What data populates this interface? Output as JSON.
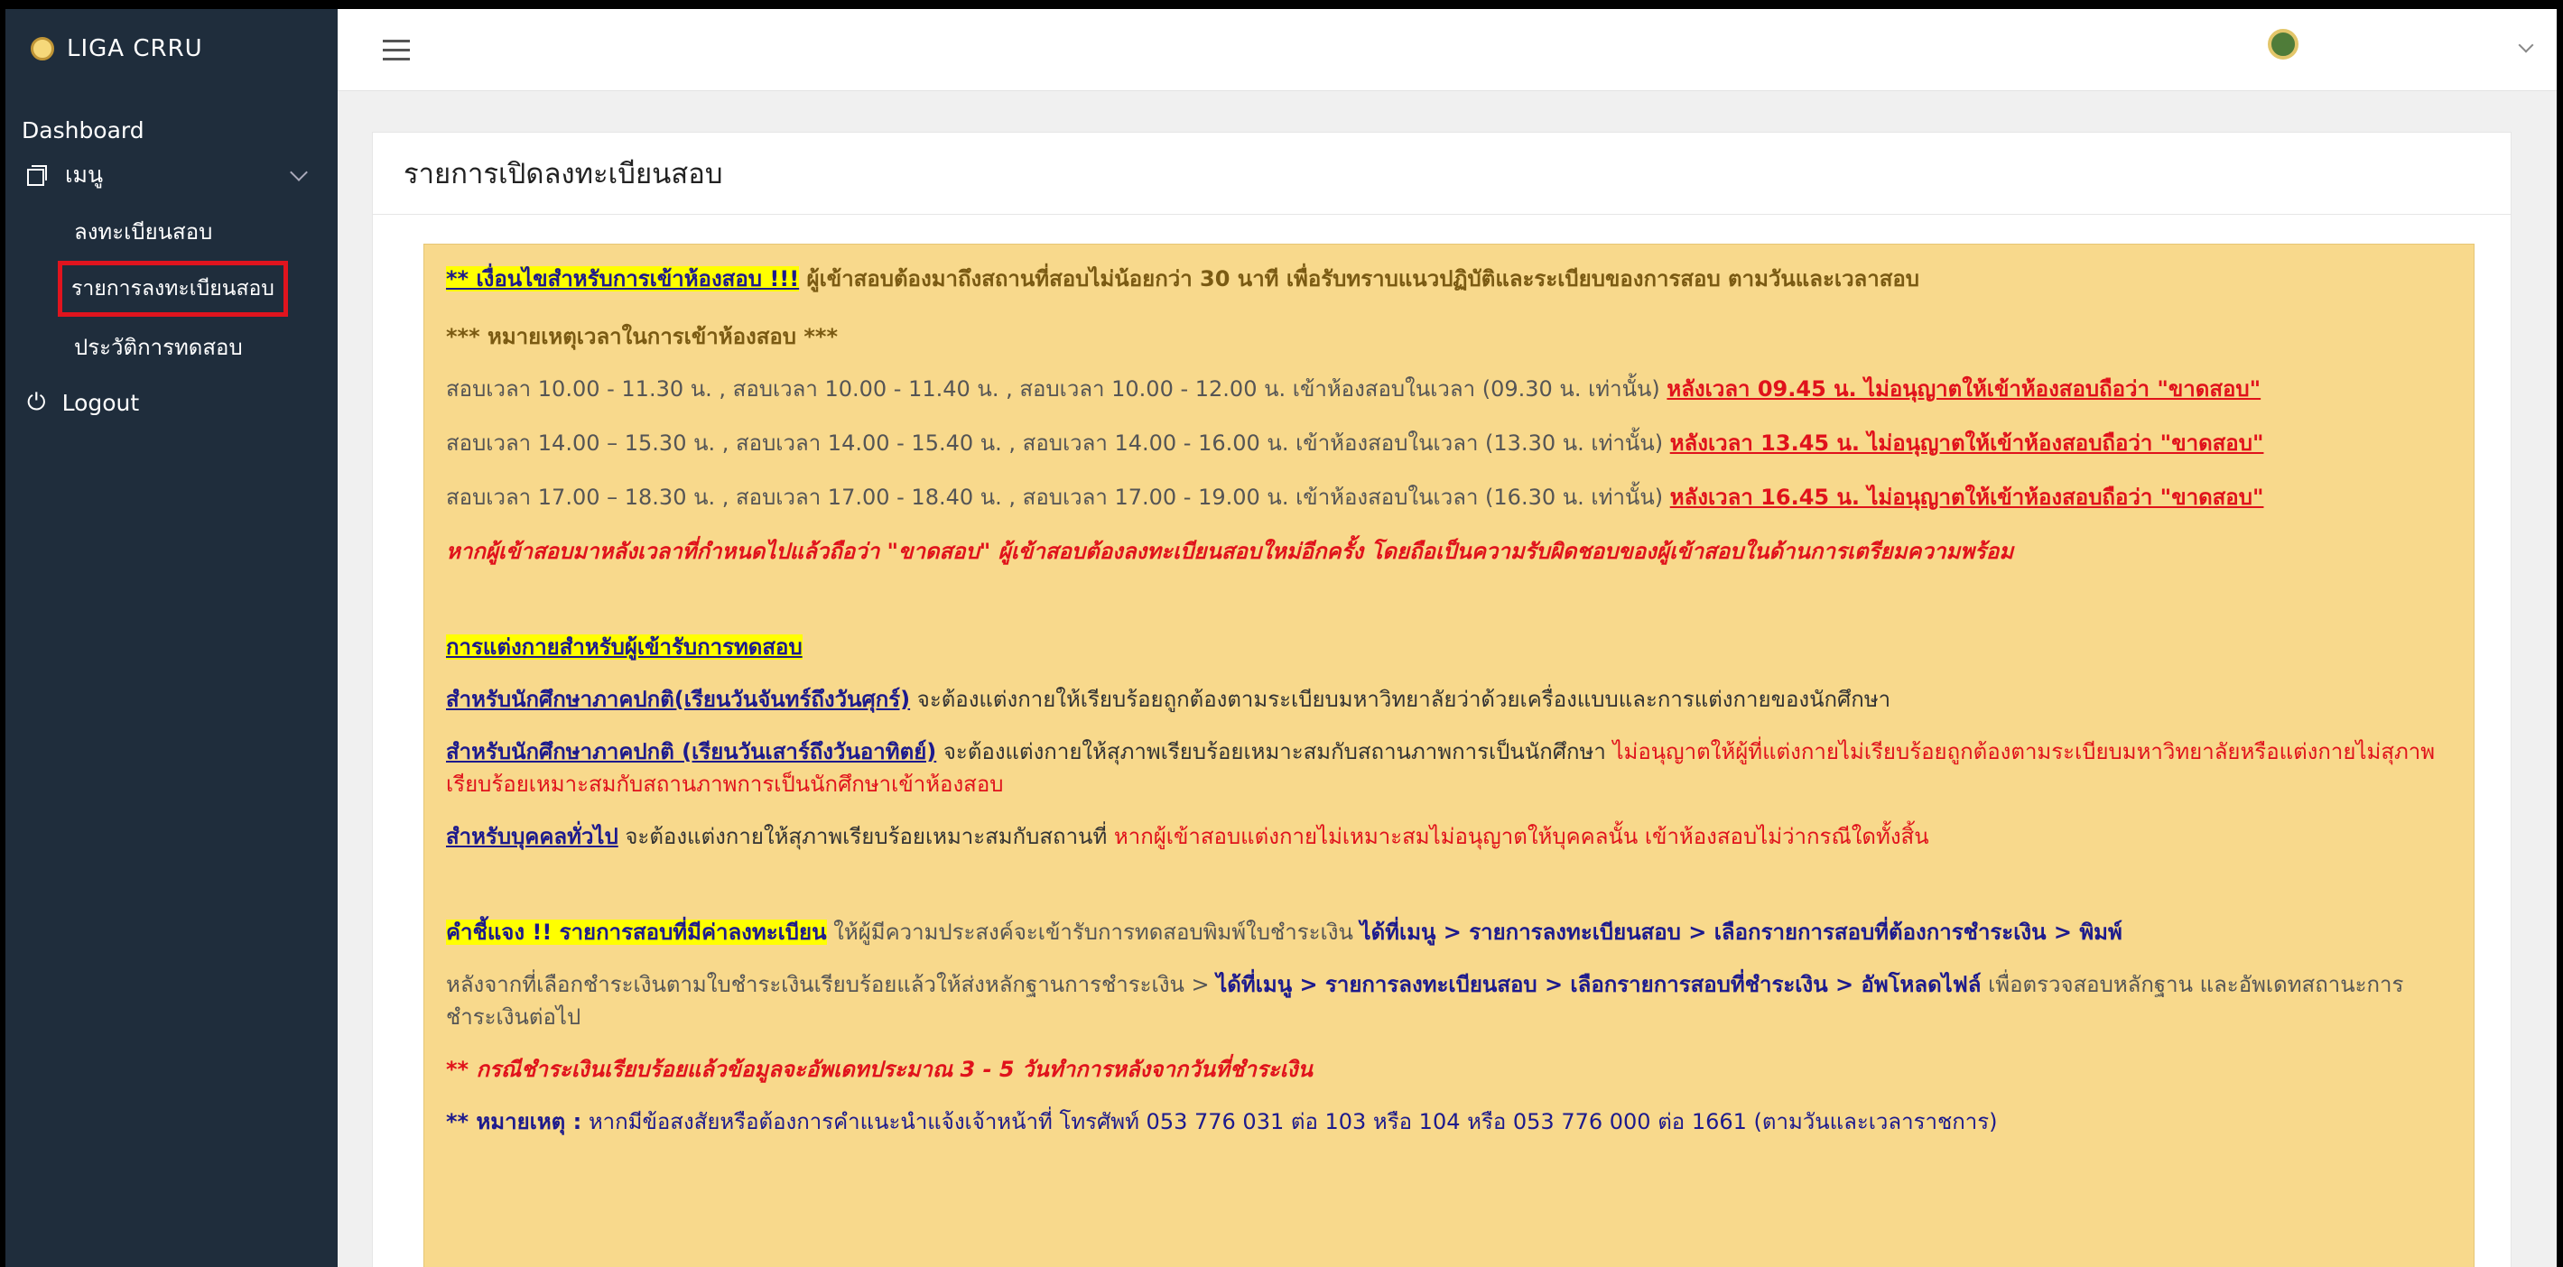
{
  "brand": {
    "title": "LIGA CRRU"
  },
  "sidebar": {
    "dashboard": "Dashboard",
    "menu": "เมนู",
    "sub_items": [
      "ลงทะเบียนสอบ",
      "รายการลงทะเบียนสอบ",
      "ประวัติการทดสอบ"
    ],
    "logout": "Logout"
  },
  "card": {
    "title": "รายการเปิดลงทะเบียนสอบ"
  },
  "notice": {
    "cond_label": "** เงื่อนไขสำหรับการเข้าห้องสอบ !!!",
    "cond_text": " ผู้เข้าสอบต้องมาถึงสถานที่สอบไม่น้อยกว่า ",
    "cond_minutes": "30 นาที",
    "cond_text2": " เพื่อรับทราบแนวปฏิบัติและระเบียบของการสอบ ตามวันและเวลาสอบ",
    "time_note_header": "*** หมายเหตุเวลาในการเข้าห้องสอบ ***",
    "rows": [
      {
        "text": "สอบเวลา 10.00 - 11.30 น. , สอบเวลา 10.00 - 11.40 น. , สอบเวลา 10.00 - 12.00 น. เข้าห้องสอบในเวลา (09.30 น. เท่านั้น) ",
        "late": "หลังเวลา 09.45 น. ไม่อนุญาตให้เข้าห้องสอบถือว่า \"ขาดสอบ\""
      },
      {
        "text": "สอบเวลา 14.00 – 15.30 น. , สอบเวลา 14.00 - 15.40 น. , สอบเวลา 14.00 - 16.00 น. เข้าห้องสอบในเวลา (13.30 น. เท่านั้น) ",
        "late": "หลังเวลา 13.45 น. ไม่อนุญาตให้เข้าห้องสอบถือว่า \"ขาดสอบ\""
      },
      {
        "text": "สอบเวลา 17.00 – 18.30 น. , สอบเวลา 17.00 - 18.40 น. , สอบเวลา 17.00 - 19.00 น. เข้าห้องสอบในเวลา (16.30 น. เท่านั้น) ",
        "late": "หลังเวลา 16.45 น. ไม่อนุญาตให้เข้าห้องสอบถือว่า \"ขาดสอบ\""
      }
    ],
    "late_warning": "หากผู้เข้าสอบมาหลังเวลาที่กำหนดไปแล้วถือว่า \"ขาดสอบ\" ผู้เข้าสอบต้องลงทะเบียนสอบใหม่อีกครั้ง โดยถือเป็นความรับผิดชอบของผู้เข้าสอบในด้านการเตรียมความพร้อม",
    "dress_header": "การแต่งกายสำหรับผู้เข้ารับการทดสอบ",
    "dress1_label": "สำหรับนักศึกษาภาคปกติ(เรียนวันจันทร์ถึงวันศุกร์)",
    "dress1_text": " จะต้องแต่งกายให้เรียบร้อยถูกต้องตามระเบียบมหาวิทยาลัยว่าด้วยเครื่องแบบและการแต่งกายของนักศึกษา",
    "dress2_label": "สำหรับนักศึกษาภาคปกติ (เรียนวันเสาร์ถึงวันอาทิตย์)",
    "dress2_text": " จะต้องแต่งกายให้สุภาพเรียบร้อยเหมาะสมกับสถานภาพการเป็นนักศึกษา ",
    "dress2_red": "ไม่อนุญาตให้ผู้ที่แต่งกายไม่เรียบร้อยถูกต้องตามระเบียบมหาวิทยาลัยหรือแต่งกายไม่สุภาพเรียบร้อยเหมาะสมกับสถานภาพการเป็นนักศึกษาเข้าห้องสอบ",
    "dress3_label": "สำหรับบุคคลทั่วไป",
    "dress3_text": " จะต้องแต่งกายให้สุภาพเรียบร้อยเหมาะสมกับสถานที่ ",
    "dress3_red": "หากผู้เข้าสอบแต่งกายไม่เหมาะสมไม่อนุญาตให้บุคคลนั้น เข้าห้องสอบไม่ว่ากรณีใดทั้งสิ้น",
    "fee_label": "คำชี้แจง !! รายการสอบที่มีค่าลงทะเบียน",
    "fee_text": " ให้ผู้มีความประสงค์จะเข้ารับการทดสอบพิมพ์ใบชำระเงิน ",
    "fee_path": "ได้ที่เมนู > รายการลงทะเบียนสอบ > เลือกรายการสอบที่ต้องการชำระเงิน > พิมพ์",
    "upload_text": "หลังจากที่เลือกชำระเงินตามใบชำระเงินเรียบร้อยแล้วให้ส่งหลักฐานการชำระเงิน > ",
    "upload_path": "ได้ที่เมนู > รายการลงทะเบียนสอบ > เลือกรายการสอบที่ชำระเงิน > อัพโหลดไฟล์",
    "upload_text2": " เพื่อตรวจสอบหลักฐาน และอัพเดทสถานะการชำระเงินต่อไป",
    "update_note": "** กรณีชำระเงินเรียบร้อยแล้วข้อมูลจะอัพเดทประมาณ 3 - 5 วันทำการหลังจากวันที่ชำระเงิน",
    "remark_label": "** หมายเหตุ :",
    "remark_text": " หากมีข้อสงสัยหรือต้องการคำแนะนำแจ้งเจ้าหน้าที่ โทรศัพท์ 053 776 031 ต่อ 103 หรือ 104 หรือ 053 776 000 ต่อ 1661 (ตามวันและเวลาราชการ)"
  }
}
